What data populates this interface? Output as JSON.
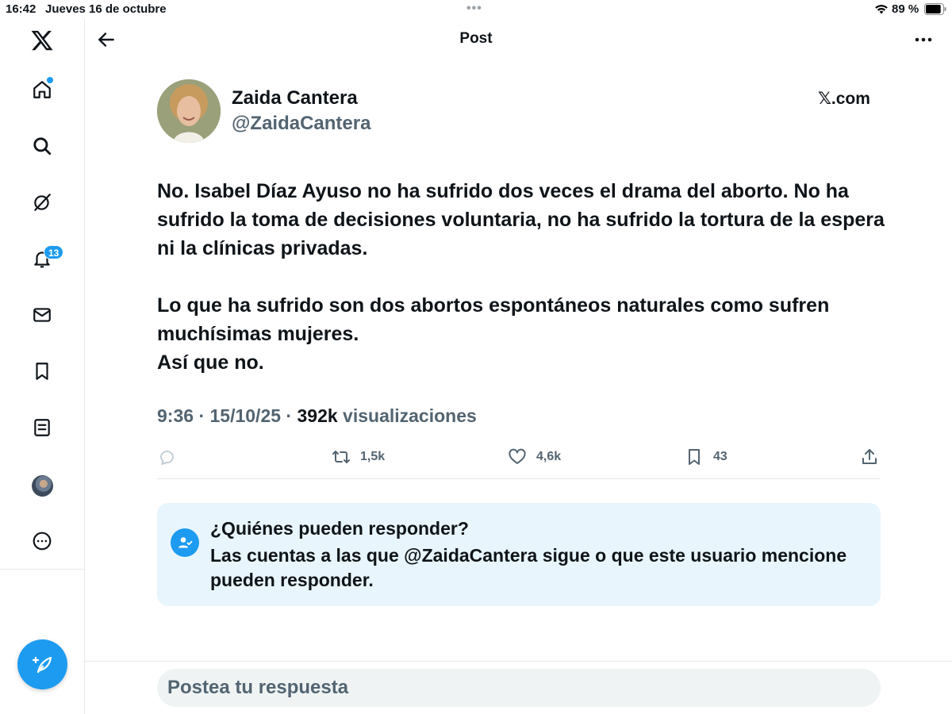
{
  "status_bar": {
    "time": "16:42",
    "date": "Jueves 16 de octubre",
    "multitask_dots": "•••",
    "battery_percent": "89 %",
    "battery_level": 0.89,
    "wifi_icon": "wifi-icon"
  },
  "sidebar": {
    "logo_icon": "x-logo-icon",
    "items": [
      {
        "name": "home",
        "icon": "home-icon",
        "has_dot": true
      },
      {
        "name": "explore",
        "icon": "search-icon"
      },
      {
        "name": "grok",
        "icon": "grok-icon"
      },
      {
        "name": "notifications",
        "icon": "bell-icon",
        "badge": "13"
      },
      {
        "name": "messages",
        "icon": "mail-icon"
      },
      {
        "name": "bookmarks",
        "icon": "bookmark-icon"
      },
      {
        "name": "lists",
        "icon": "list-icon"
      },
      {
        "name": "profile",
        "icon": "avatar"
      },
      {
        "name": "more",
        "icon": "more-circle-icon"
      }
    ],
    "compose_icon": "compose-feather-icon"
  },
  "header": {
    "title": "Post",
    "back_icon": "back-arrow-icon",
    "more_icon": "more-horizontal-icon"
  },
  "post": {
    "author_name": "Zaida Cantera",
    "author_handle": "@ZaidaCantera",
    "source": "𝕏.com",
    "paragraphs": [
      "No. Isabel Díaz Ayuso no ha sufrido dos veces el drama del aborto. No ha sufrido la toma de decisiones voluntaria, no ha sufrido la  tortura de la espera ni la clínicas privadas.",
      "Lo que ha sufrido son dos abortos espontáneos naturales como sufren muchísimas  mujeres.\nAsí que no."
    ],
    "time": "9:36",
    "date": "15/10/25",
    "separator": "·",
    "views_count": "392k",
    "views_label": "visualizaciones",
    "actions": {
      "reply_count": "",
      "repost_count": "1,5k",
      "like_count": "4,6k",
      "bookmark_count": "43"
    }
  },
  "reply_restriction": {
    "title": "¿Quiénes pueden responder?",
    "description": "Las cuentas a las que @ZaidaCantera sigue o que este usuario mencione pueden responder."
  },
  "reply_input": {
    "placeholder": "Postea tu respuesta"
  },
  "colors": {
    "accent": "#1d9bf0",
    "text_primary": "#0f1419",
    "text_secondary": "#536471",
    "reply_box_bg": "#e8f5fd"
  }
}
